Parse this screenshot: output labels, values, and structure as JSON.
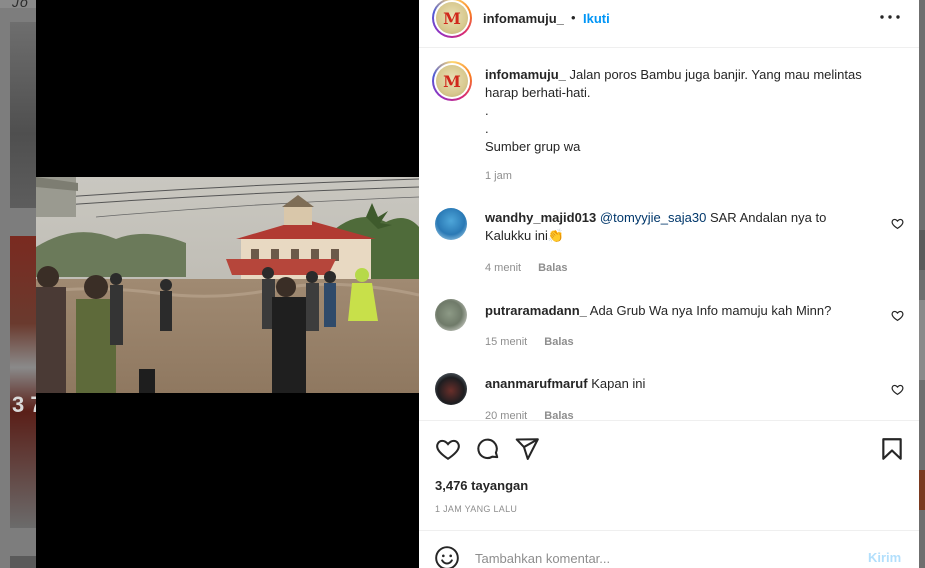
{
  "background": {
    "top_text": "Jo",
    "thumb_text": "3 7"
  },
  "post": {
    "username": "infomamuju_",
    "avatar_letter": "M",
    "follow_separator": "•",
    "follow_label": "Ikuti",
    "more_icon": "more-horizontal-icon",
    "caption": {
      "username": "infomamuju_",
      "lines": [
        "Jalan poros Bambu juga banjir. Yang mau melintas harap berhati-hati.",
        ".",
        ".",
        "Sumber grup wa"
      ],
      "time": "1 jam"
    },
    "comments": [
      {
        "username": "wandhy_majid013",
        "mention": "@tomyyjie_saja30",
        "text": "SAR Andalan nya to Kalukku ini",
        "emoji": "👏",
        "time": "4 menit",
        "reply_label": "Balas"
      },
      {
        "username": "putraramadann_",
        "text": "Ada Grub Wa nya Info mamuju kah Minn?",
        "time": "15 menit",
        "reply_label": "Balas"
      },
      {
        "username": "ananmarufmaruf",
        "text": "Kapan ini",
        "time": "20 menit",
        "reply_label": "Balas"
      }
    ],
    "views": "3,476 tayangan",
    "posted": "1 JAM YANG LALU",
    "composer": {
      "placeholder": "Tambahkan komentar...",
      "post_label": "Kirim"
    }
  },
  "colors": {
    "accent": "#0095f6",
    "post_disabled": "#b2dffc",
    "secondary_text": "#8e8e8e"
  }
}
